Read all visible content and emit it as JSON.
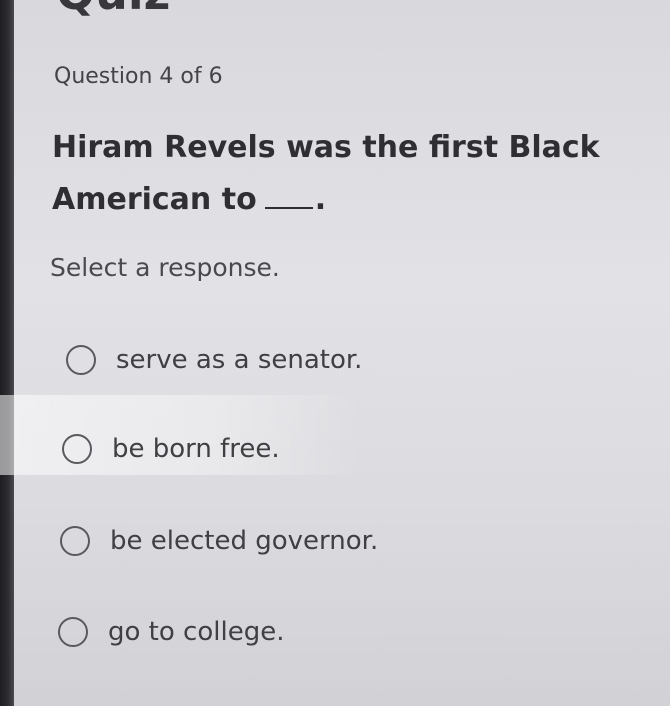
{
  "header": {
    "title": "Quiz"
  },
  "question": {
    "counter": "Question 4 of 6",
    "text_before_blank": "Hiram Revels was the first Black American to",
    "text_after_blank": ".",
    "prompt": "Select a response."
  },
  "options": [
    {
      "label": "serve as a senator.",
      "selected": false
    },
    {
      "label": "be born free.",
      "selected": false
    },
    {
      "label": "be elected governor.",
      "selected": false
    },
    {
      "label": "go to college.",
      "selected": false
    }
  ]
}
